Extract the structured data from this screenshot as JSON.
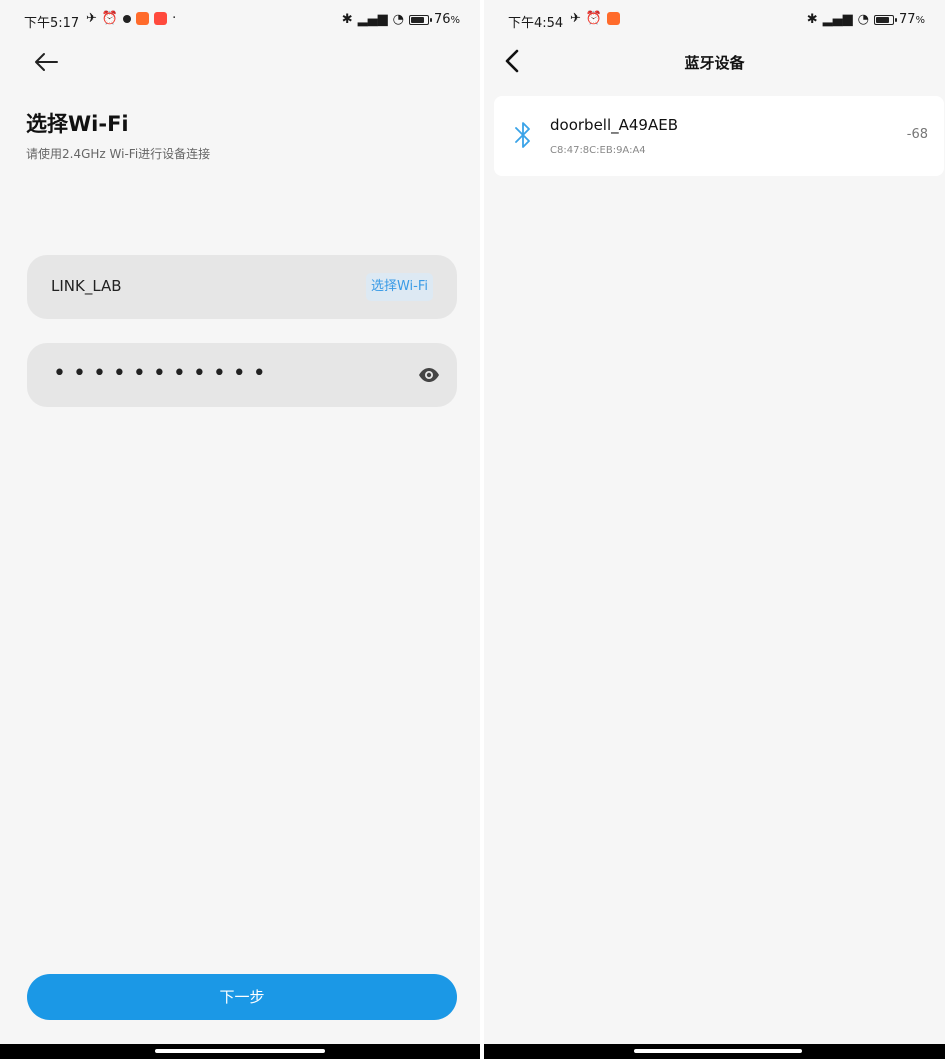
{
  "left_screen": {
    "status_bar": {
      "time": "下午5:17",
      "battery": "76",
      "battery_unit": "%"
    },
    "title": "选择Wi-Fi",
    "subtitle": "请使用2.4GHz Wi-Fi进行设备连接",
    "wifi_field": {
      "value": "LINK_LAB",
      "action_label": "选择Wi-Fi"
    },
    "password_field": {
      "masked_value": "•••••••••••"
    },
    "next_button": "下一步",
    "accent_color": "#1b98e6"
  },
  "right_screen": {
    "status_bar": {
      "time": "下午4:54",
      "battery": "77",
      "battery_unit": "%"
    },
    "title": "蓝牙设备",
    "devices": [
      {
        "name": "doorbell_A49AEB",
        "mac": "C8:47:8C:EB:9A:A4",
        "rssi": "-68"
      }
    ],
    "icon_color": "#3aa3e8"
  }
}
